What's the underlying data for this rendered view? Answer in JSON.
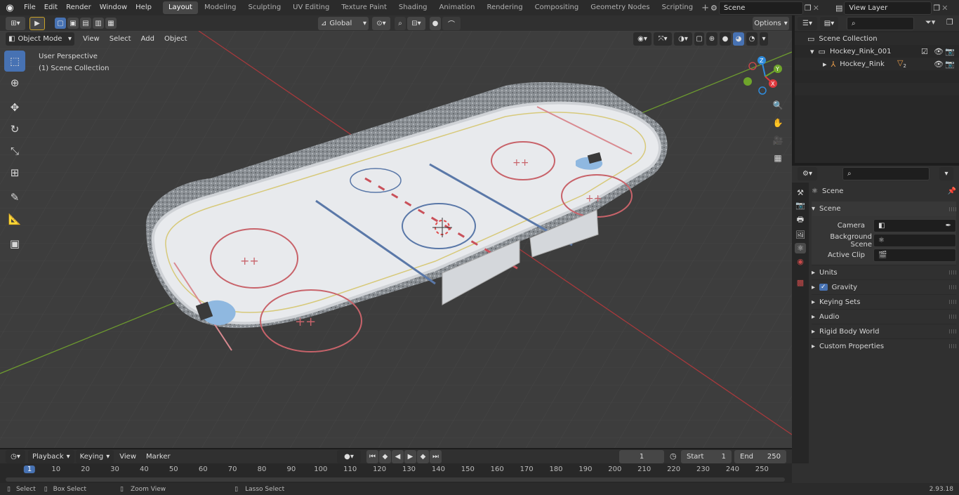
{
  "menus": [
    "File",
    "Edit",
    "Render",
    "Window",
    "Help"
  ],
  "workspaces": [
    "Layout",
    "Modeling",
    "Sculpting",
    "UV Editing",
    "Texture Paint",
    "Shading",
    "Animation",
    "Rendering",
    "Compositing",
    "Geometry Nodes",
    "Scripting"
  ],
  "active_workspace": "Layout",
  "scene_name": "Scene",
  "view_layer": "View Layer",
  "viewport": {
    "mode": "Object Mode",
    "menus": [
      "View",
      "Select",
      "Add",
      "Object"
    ],
    "orientation": "Global",
    "options": "Options",
    "overlay_line1": "User Perspective",
    "overlay_line2": "(1) Scene Collection"
  },
  "outliner": {
    "root": "Scene Collection",
    "collection": "Hockey_Rink_001",
    "object": "Hockey_Rink",
    "object_badge": "2"
  },
  "properties": {
    "context": "Scene",
    "panel": "Scene",
    "camera_label": "Camera",
    "bg_scene_label": "Background Scene",
    "active_clip_label": "Active Clip",
    "subpanels": [
      "Units",
      "Gravity",
      "Keying Sets",
      "Audio",
      "Rigid Body World",
      "Custom Properties"
    ]
  },
  "timeline": {
    "menus": [
      "Playback",
      "Keying",
      "View",
      "Marker"
    ],
    "current_frame": "1",
    "start_label": "Start",
    "start": "1",
    "end_label": "End",
    "end": "250",
    "ruler": [
      "1",
      "10",
      "20",
      "30",
      "40",
      "50",
      "60",
      "70",
      "80",
      "90",
      "100",
      "110",
      "120",
      "130",
      "140",
      "150",
      "160",
      "170",
      "180",
      "190",
      "200",
      "210",
      "220",
      "230",
      "240",
      "250"
    ]
  },
  "statusbar": {
    "select": "Select",
    "box_select": "Box Select",
    "zoom_view": "Zoom View",
    "lasso_select": "Lasso Select",
    "version": "2.93.18"
  },
  "colors": {
    "accent": "#4772b3",
    "x_axis": "#e0393e",
    "y_axis": "#6fa52b",
    "z_axis": "#2f8bdc"
  }
}
